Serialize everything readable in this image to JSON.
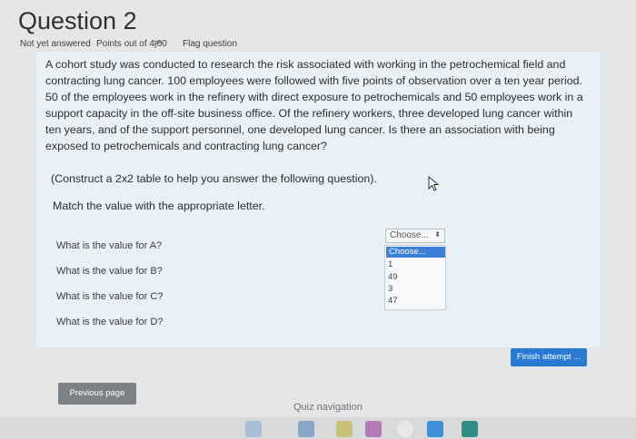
{
  "question": {
    "title": "Question 2",
    "status": "Not yet answered",
    "points": "Points out of 4.00",
    "flag_label": "Flag question",
    "text": "A cohort study was conducted to research the risk associated with working in the petrochemical field and contracting lung cancer. 100 employees were followed with five points of observation over a ten year period. 50 of the employees work in the refinery with direct exposure to petrochemicals and 50 employees work in a support capacity in the off-site business office. Of the refinery workers, three developed lung cancer within ten years, and of the support personnel, one developed lung cancer. Is there an association with being exposed to petrochemicals and contracting lung cancer?",
    "instruction": "(Construct a 2x2 table to help you answer the following question).",
    "match_prompt": "Match the value with the appropriate letter.",
    "prompts": [
      "What is the value for A?",
      "What is the value for B?",
      "What is the value for C?",
      "What is the value for D?"
    ]
  },
  "select": {
    "current": "Choose...",
    "options": [
      "Choose...",
      "1",
      "49",
      "3",
      "47"
    ]
  },
  "buttons": {
    "finish": "Finish attempt ...",
    "previous": "Previous page"
  },
  "quiz_navigation_label": "Quiz navigation",
  "colors": {
    "primary": "#2a7ad4",
    "secondary": "#7c8186",
    "question_bg": "#e9f1f6",
    "highlight": "#3c7fd6"
  }
}
